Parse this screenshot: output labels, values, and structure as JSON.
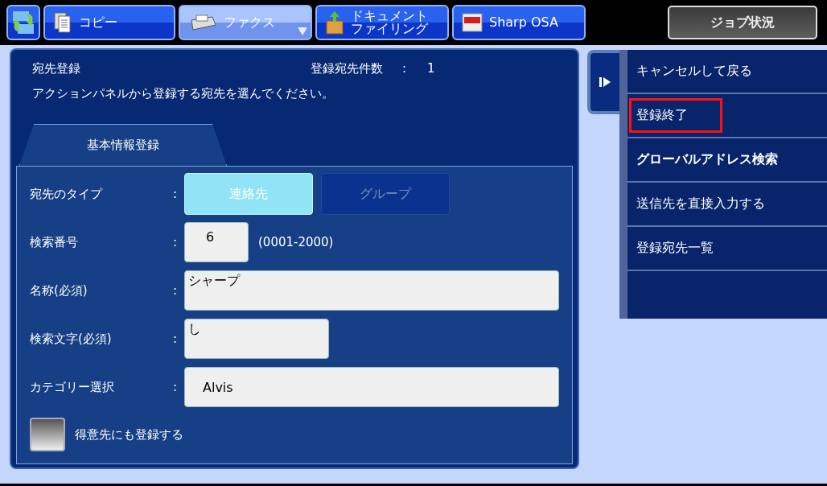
{
  "mode_tabs": [
    {
      "kind": "home",
      "selected": false
    },
    {
      "kind": "copy",
      "label": "コピー",
      "selected": false
    },
    {
      "kind": "fax",
      "label": "ファクス",
      "selected": true
    },
    {
      "kind": "filing",
      "label_lines": [
        "ドキュメント",
        "ファイリング"
      ],
      "selected": false
    },
    {
      "kind": "osa",
      "label": "Sharp OSA",
      "selected": false
    }
  ],
  "job_status_button": "ジョブ状況",
  "panel": {
    "title": "宛先登録",
    "count_label": "登録宛先件数",
    "count_colon": ":",
    "count": "1",
    "message": "アクションパネルから登録する宛先を選んでください。",
    "tab": "基本情報登録",
    "rows": [
      {
        "kind": "choice",
        "label": "宛先のタイプ",
        "colon": ":",
        "options": [
          {
            "label": "連絡先",
            "selected": true,
            "disabled": false
          },
          {
            "label": "グループ",
            "selected": false,
            "disabled": true
          }
        ]
      },
      {
        "kind": "number",
        "label": "検索番号",
        "colon": ":",
        "value": "6",
        "hint": "(0001-2000)"
      },
      {
        "kind": "text",
        "label": "名称(必須)",
        "colon": ":",
        "value": "シャープ"
      },
      {
        "kind": "short",
        "label": "検索文字(必須)",
        "colon": ":",
        "value": "し"
      },
      {
        "kind": "select",
        "label": "カテゴリー選択",
        "colon": ":",
        "value": "Alvis"
      }
    ],
    "checkbox": {
      "label": "得意先にも登録する",
      "checked": false
    }
  },
  "action_panel": {
    "items": [
      {
        "label": "キャンセルして戻る",
        "highlighted": false,
        "bold": false
      },
      {
        "label": "登録終了",
        "highlighted": true,
        "bold": false
      },
      {
        "label": "グローバルアドレス検索",
        "highlighted": false,
        "bold": true
      },
      {
        "label": "送信先を直接入力する",
        "highlighted": false,
        "bold": false
      },
      {
        "label": "登録宛先一覧",
        "highlighted": false,
        "bold": false
      }
    ]
  }
}
